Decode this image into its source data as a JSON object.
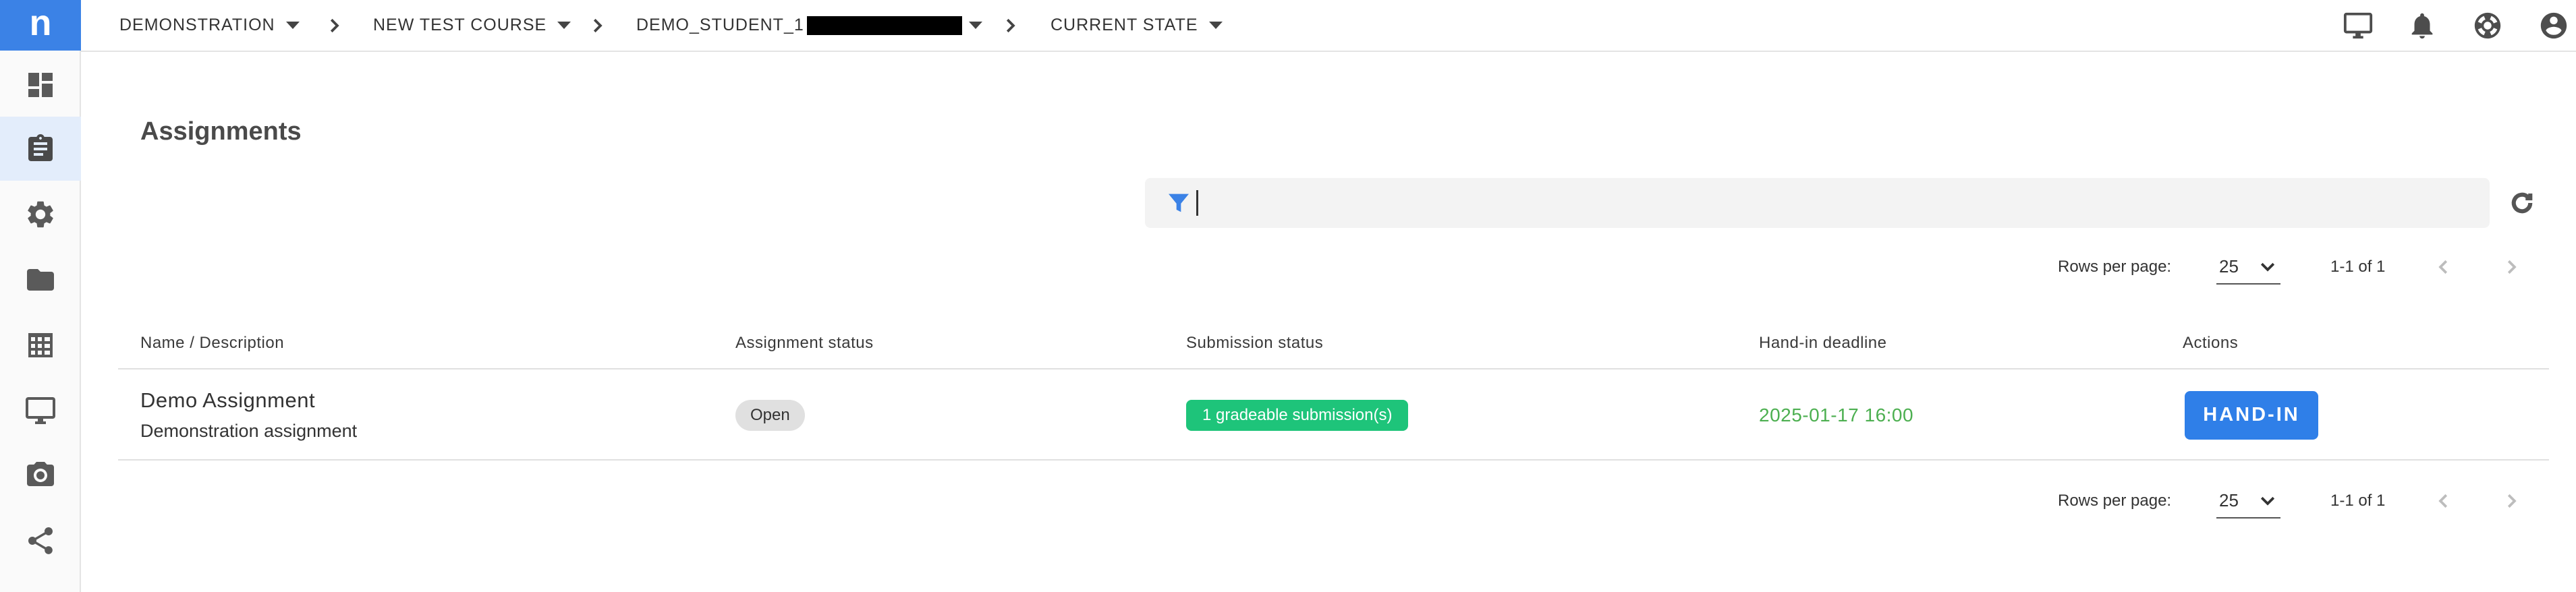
{
  "app": {
    "logo_letter": "n"
  },
  "sidebar": {
    "items": [
      {
        "icon": "dashboard-icon"
      },
      {
        "icon": "assignment-clipboard-icon",
        "active": true
      },
      {
        "icon": "gear-icon"
      },
      {
        "icon": "folder-icon"
      },
      {
        "icon": "grid-table-icon"
      },
      {
        "icon": "monitor-icon"
      },
      {
        "icon": "camera-icon"
      },
      {
        "icon": "share-icon"
      }
    ]
  },
  "breadcrumb": {
    "items": [
      {
        "label": "DEMONSTRATION"
      },
      {
        "label": "NEW TEST COURSE"
      },
      {
        "label": "DEMO_STUDENT_1"
      },
      {
        "label": "CURRENT STATE"
      }
    ]
  },
  "topbar_icons": [
    "monitor-icon",
    "bell-icon",
    "help-lifebuoy-icon",
    "account-icon"
  ],
  "page": {
    "title": "Assignments"
  },
  "search": {
    "value": "",
    "placeholder": ""
  },
  "pagination": {
    "rows_per_page_label": "Rows per page:",
    "rows_per_page": "25",
    "range": "1-1 of 1"
  },
  "table": {
    "headers": {
      "name": "Name / Description",
      "assignment_status": "Assignment status",
      "submission_status": "Submission status",
      "deadline": "Hand-in deadline",
      "actions": "Actions"
    },
    "rows": [
      {
        "name": "Demo Assignment",
        "description": "Demonstration assignment",
        "assignment_status": "Open",
        "submission_status": "1 gradeable submission(s)",
        "deadline": "2025-01-17 16:00",
        "action": "HAND-IN"
      }
    ]
  },
  "colors": {
    "accent": "#3b82e6",
    "button": "#2f7fe8",
    "success_chip": "#1ec47a",
    "deadline_text": "#4caf50"
  }
}
